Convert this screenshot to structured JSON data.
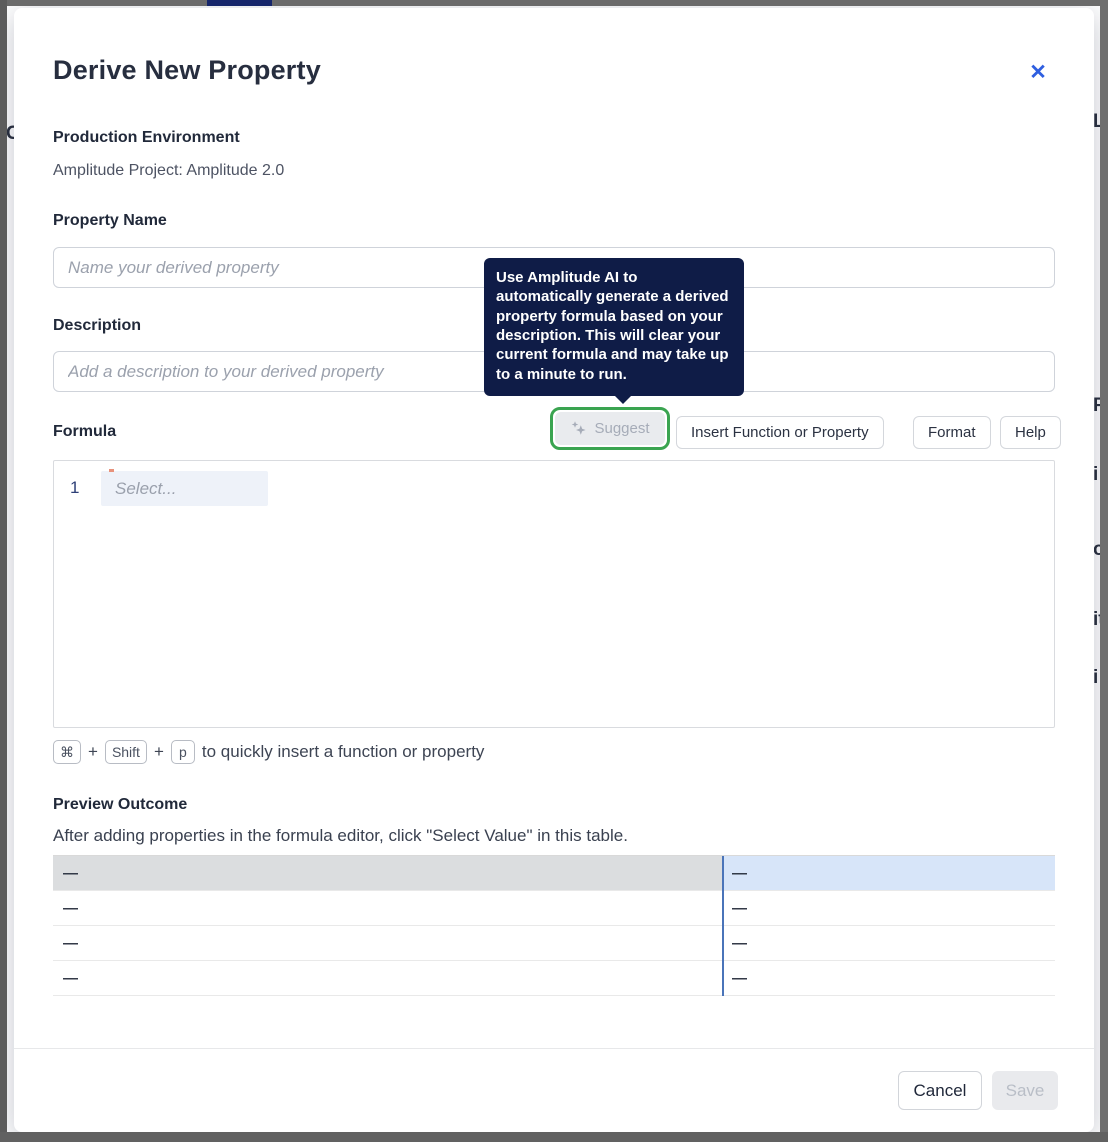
{
  "background": {
    "fragments": [
      "C",
      "L",
      "P",
      "i",
      "o",
      "it",
      "i"
    ]
  },
  "modal": {
    "title": "Derive New Property",
    "close_icon": "✕",
    "environment": {
      "label": "Production Environment",
      "project": "Amplitude Project: Amplitude 2.0"
    },
    "property_name": {
      "label": "Property Name",
      "placeholder": "Name your derived property"
    },
    "description": {
      "label": "Description",
      "placeholder": "Add a description to your derived property"
    },
    "tooltip": {
      "text": "Use Amplitude AI to automatically generate a derived property formula based on your description. This will clear your current formula and may take up to a minute to run."
    },
    "formula": {
      "label": "Formula",
      "buttons": {
        "suggest": "Suggest",
        "insert": "Insert Function or Property",
        "format": "Format",
        "help": "Help"
      },
      "editor": {
        "line_number": "1",
        "placeholder": "Select..."
      },
      "shortcut": {
        "keys": [
          "⌘",
          "Shift",
          "p"
        ],
        "plus": "+",
        "text": "to quickly insert a function or property"
      }
    },
    "preview": {
      "label": "Preview Outcome",
      "caption": "After adding properties in the formula editor, click \"Select Value\" in this table.",
      "table": {
        "rows": [
          [
            "—",
            "—"
          ],
          [
            "—",
            "—"
          ],
          [
            "—",
            "—"
          ],
          [
            "—",
            "—"
          ]
        ]
      }
    },
    "footer": {
      "cancel": "Cancel",
      "save": "Save"
    },
    "colors": {
      "accent_blue": "#2f5fe0",
      "tooltip_bg": "#0f1c47",
      "highlight_green": "#3aa450",
      "selected_row_left": "#dbdddf",
      "selected_row_right": "#d7e5f9",
      "table_divider_blue": "#4a74b9"
    }
  }
}
